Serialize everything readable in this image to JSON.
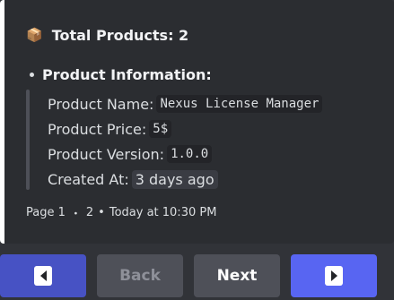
{
  "embed": {
    "title_icon": "package-icon",
    "title": "Total Products: 2",
    "section_title": "Product Information:",
    "fields": [
      {
        "label": "Product Name:",
        "value": "Nexus License Manager",
        "style": "code"
      },
      {
        "label": "Product Price:",
        "value": "5$",
        "style": "code"
      },
      {
        "label": "Product Version:",
        "value": "1.0.0",
        "style": "code"
      },
      {
        "label": "Created At:",
        "value": "3 days ago",
        "style": "timestamp"
      }
    ],
    "footer": {
      "page": "Page 1",
      "sep1": "・",
      "total": "2",
      "sep2": "•",
      "timestamp": "Today at 10:30 PM"
    },
    "accent_color": "#ffffff"
  },
  "buttons": {
    "prev_icon": "arrow-left-icon",
    "back_label": "Back",
    "next_label": "Next",
    "next_icon": "arrow-right-icon",
    "colors": {
      "blurple": "#5865f2",
      "blurple_dim": "#4752c4",
      "secondary": "#4e5058"
    }
  }
}
